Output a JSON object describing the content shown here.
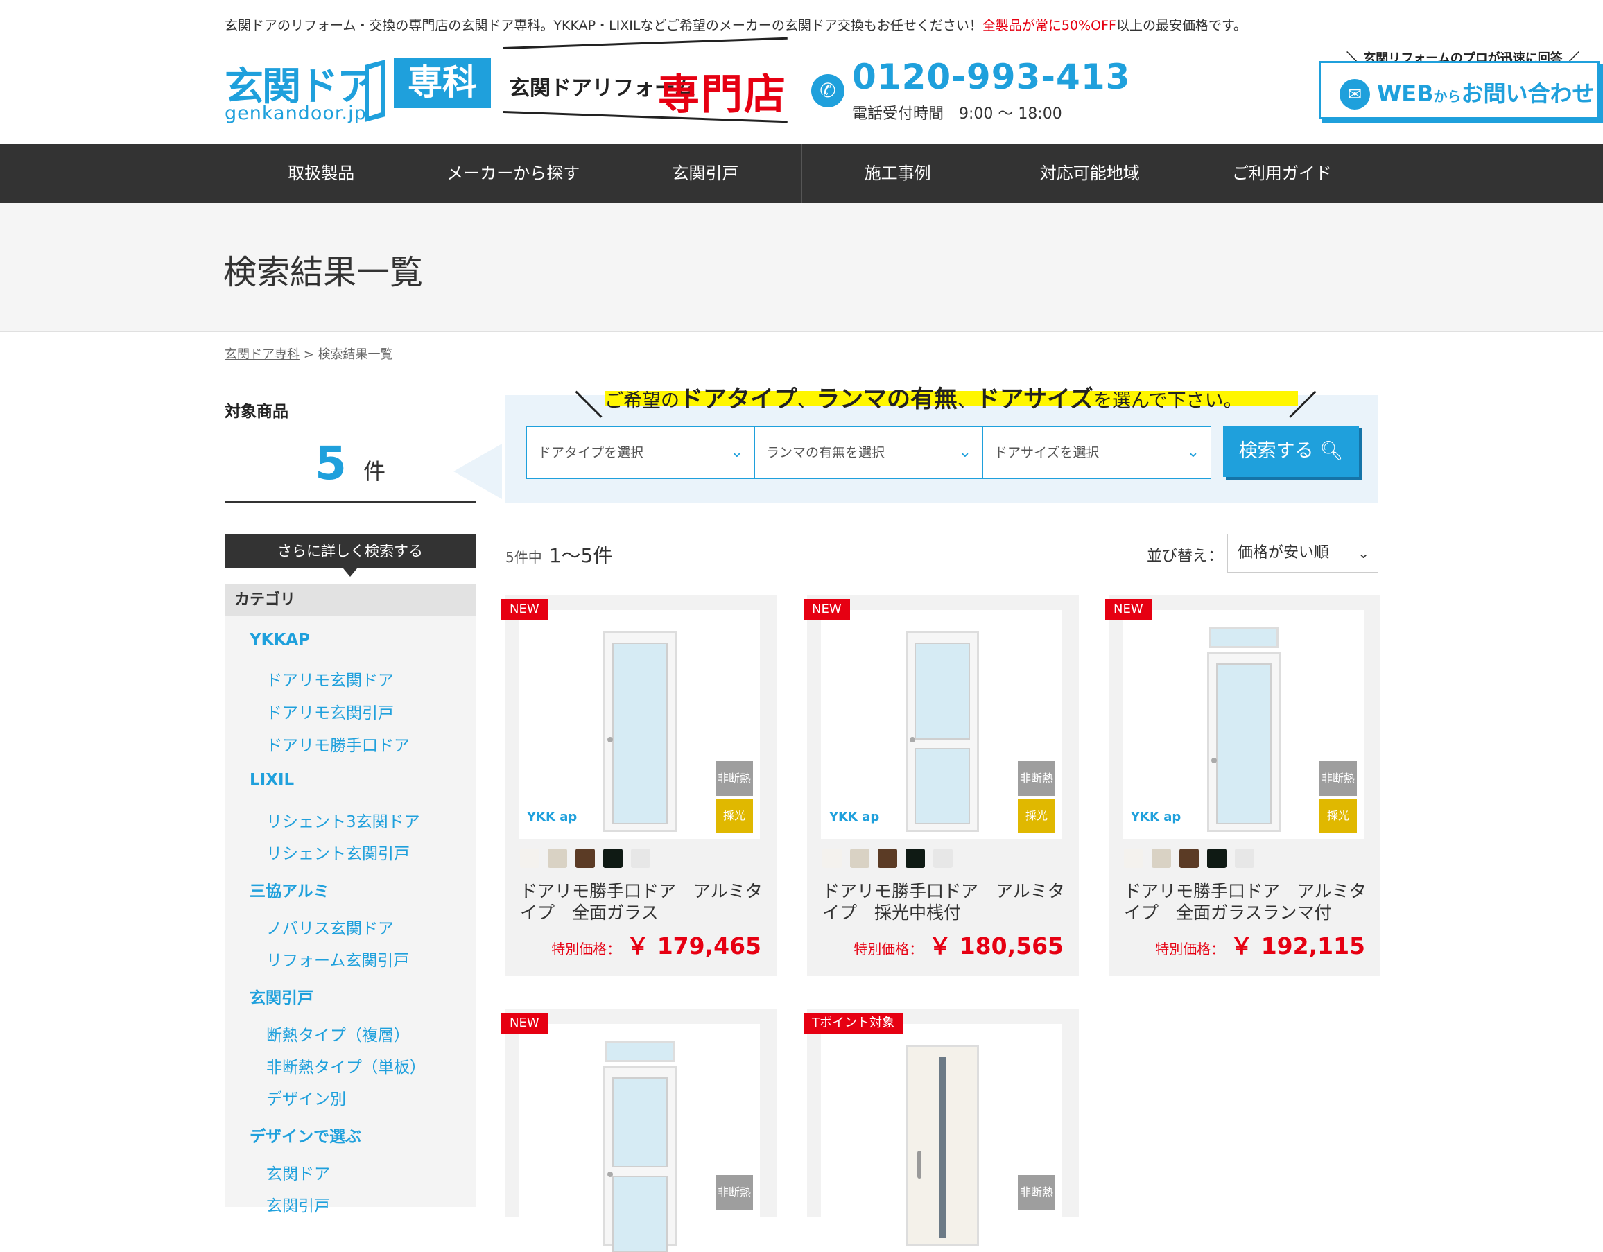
{
  "header": {
    "tagline": "玄関ドアのリフォーム・交換の専門店の玄関ドア専科。YKKAP・LIXILなどご希望のメーカーの玄関ドア交換もお任せください！",
    "tagline_red": "全製品が常に50%OFF",
    "tagline_tail": "以上の最安価格です。",
    "logo_main": "玄関ドア",
    "logo_box": "専科",
    "logo_sub": "genkandoor.jp",
    "banner_text": "玄関ドアリフォーム",
    "banner_red": "専門店",
    "tel": "0120-993-413",
    "tel_hours": "電話受付時間　9:00 ～ 18:00",
    "cta_top": "玄関リフォームのプロが迅速に回答",
    "cta_web": "WEB",
    "cta_kara": "から",
    "cta_label": "お問い合わせ",
    "brand_color": "#1fa0dc",
    "accent_red": "#e60012"
  },
  "nav": [
    "取扱製品",
    "メーカーから探す",
    "玄関引戸",
    "施工事例",
    "対応可能地域",
    "ご利用ガイド"
  ],
  "page_title": "検索結果一覧",
  "breadcrumb": {
    "home": "玄関ドア専科",
    "sep": ">",
    "current": "検索結果一覧"
  },
  "sidebar": {
    "target_label": "対象商品",
    "count": "5",
    "count_unit": "件",
    "refine_label": "さらに詳しく検索する",
    "category_label": "カテゴリ",
    "groups": [
      {
        "name": "YKKAP",
        "items": [
          "ドアリモ玄関ドア",
          "ドアリモ玄関引戸",
          "ドアリモ勝手口ドア"
        ]
      },
      {
        "name": "LIXIL",
        "items": [
          "リシェント3玄関ドア",
          "リシェント玄関引戸"
        ]
      },
      {
        "name": "三協アルミ",
        "items": [
          "ノバリス玄関ドア",
          "リフォーム玄関引戸"
        ]
      },
      {
        "name": "玄関引戸",
        "items": [
          "断熱タイプ（複層）",
          "非断熱タイプ（単板）",
          "デザイン別"
        ]
      },
      {
        "name": "デザインで選ぶ",
        "items": [
          "玄関ドア",
          "玄関引戸"
        ]
      }
    ]
  },
  "search": {
    "heading_pre": "ご希望の",
    "heading_b1": "ドアタイプ",
    "heading_sep1": "、",
    "heading_b2": "ランマの有無",
    "heading_sep2": "、",
    "heading_b3": "ドアサイズ",
    "heading_post": "を選んで下さい。",
    "select_door_type": "ドアタイプを選択",
    "select_ranma": "ランマの有無を選択",
    "select_size": "ドアサイズを選択",
    "button": "検索する"
  },
  "results": {
    "total_text": "5件中",
    "range_text": "1〜5件",
    "sort_label": "並び替え：",
    "sort_value": "価格が安い順"
  },
  "swatch_colors": [
    "#f4f2ee",
    "#d9d2c4",
    "#5b3b25",
    "#0f1a14",
    "#e7e7e7"
  ],
  "products": [
    {
      "badge": "NEW",
      "title": "ドアリモ勝手口ドア　アルミタイプ　全面ガラス",
      "price_label": "特別価格：",
      "price": "￥ 179,465",
      "tag1": "非断熱",
      "tag2": "採光",
      "brand": "YKK ap"
    },
    {
      "badge": "NEW",
      "title": "ドアリモ勝手口ドア　アルミタイプ　採光中桟付",
      "price_label": "特別価格：",
      "price": "￥ 180,565",
      "tag1": "非断熱",
      "tag2": "採光",
      "brand": "YKK ap"
    },
    {
      "badge": "NEW",
      "title": "ドアリモ勝手口ドア　アルミタイプ　全面ガラスランマ付",
      "price_label": "特別価格：",
      "price": "￥ 192,115",
      "tag1": "非断熱",
      "tag2": "採光",
      "brand": "YKK ap"
    },
    {
      "badge": "NEW",
      "tag1": "非断熱"
    },
    {
      "badge": "Tポイント対象",
      "tag1": "非断熱"
    }
  ]
}
